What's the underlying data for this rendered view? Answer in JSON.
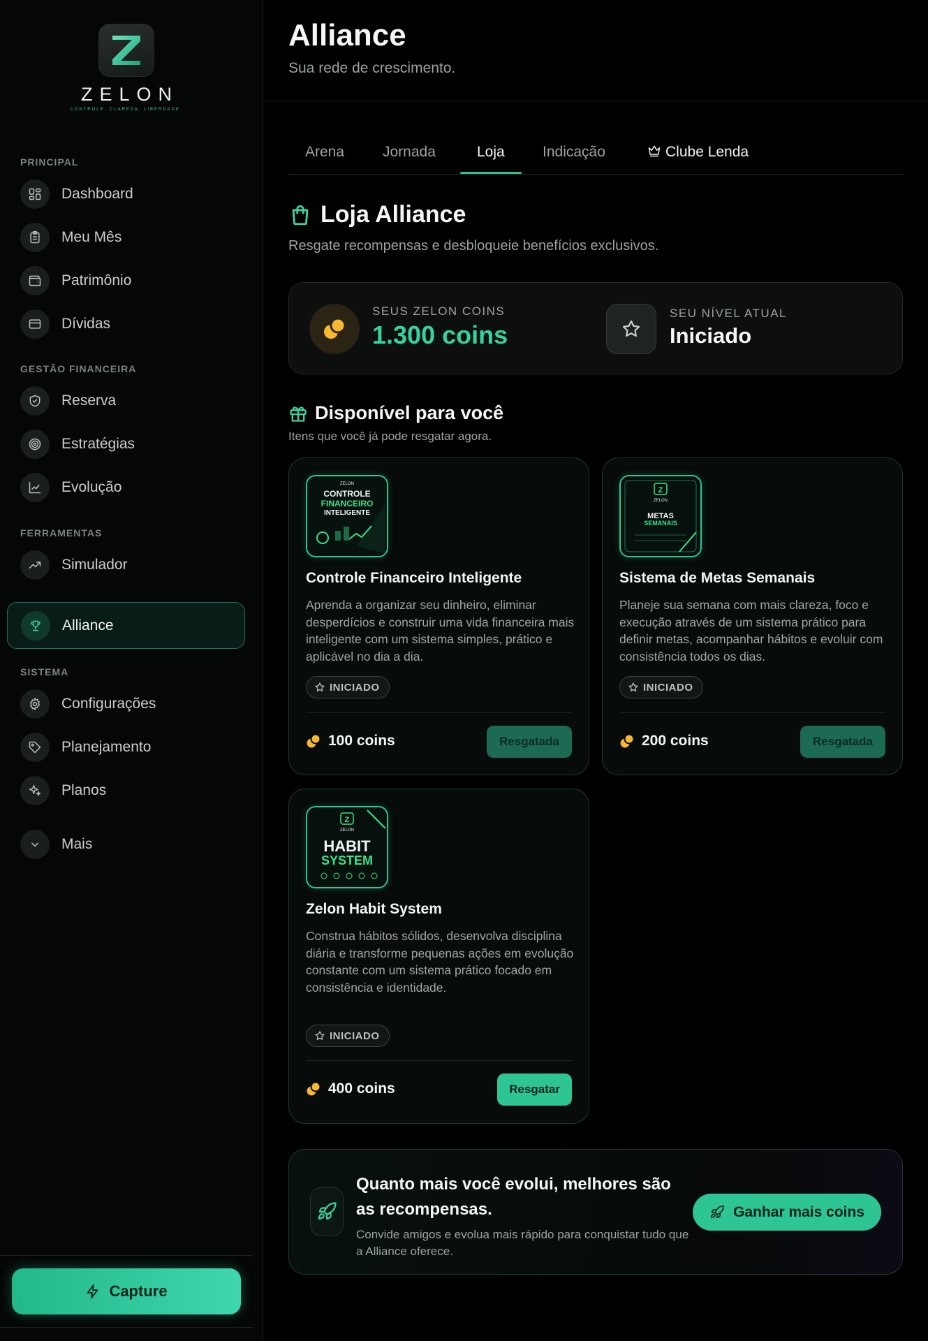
{
  "brand": {
    "name": "ZELON",
    "letter": "Z",
    "tagline": "CONTROLE. CLAREZA. LIBERDADE."
  },
  "sidebar": {
    "sections": [
      {
        "title": "PRINCIPAL"
      },
      {
        "title": "GESTÃO FINANCEIRA"
      },
      {
        "title": "FERRAMENTAS"
      },
      {
        "title": "SISTEMA"
      }
    ],
    "items": [
      {
        "label": "Dashboard",
        "icon": "dashboard-icon"
      },
      {
        "label": "Meu Mês",
        "icon": "clipboard-icon"
      },
      {
        "label": "Patrimônio",
        "icon": "wallet-icon"
      },
      {
        "label": "Dívidas",
        "icon": "credit-card-icon"
      },
      {
        "label": "Reserva",
        "icon": "shield-icon"
      },
      {
        "label": "Estratégias",
        "icon": "target-icon"
      },
      {
        "label": "Evolução",
        "icon": "chart-line-icon"
      },
      {
        "label": "Simulador",
        "icon": "trending-up-icon"
      },
      {
        "label": "Alliance",
        "icon": "trophy-icon",
        "active": true
      },
      {
        "label": "Configurações",
        "icon": "gear-icon"
      },
      {
        "label": "Planejamento",
        "icon": "tag-icon"
      },
      {
        "label": "Planos",
        "icon": "sparkles-icon"
      },
      {
        "label": "Mais",
        "icon": "chevron-down-icon"
      }
    ],
    "capture_label": "Capture"
  },
  "header": {
    "title": "Alliance",
    "subtitle": "Sua rede de crescimento."
  },
  "tabs": [
    {
      "label": "Arena"
    },
    {
      "label": "Jornada"
    },
    {
      "label": "Loja",
      "active": true
    },
    {
      "label": "Indicação"
    },
    {
      "label": "Clube Lenda",
      "icon": "crown-icon"
    }
  ],
  "store": {
    "title": "Loja Alliance",
    "subtitle": "Resgate recompensas e desbloqueie benefícios exclusivos.",
    "coins_label": "SEUS ZELON COINS",
    "coins_value": "1.300 coins",
    "level_label": "SEU NÍVEL ATUAL",
    "level_value": "Iniciado",
    "available_title": "Disponível para você",
    "available_subtitle": "Itens que você já pode resgatar agora."
  },
  "products": [
    {
      "title": "Controle Financeiro Inteligente",
      "description": "Aprenda a organizar seu dinheiro, eliminar desperdícios e construir uma vida financeira mais inteligente com um sistema simples, prático e aplicável no dia a dia.",
      "badge": "INICIADO",
      "price": "100 coins",
      "action": "Resgatada",
      "thumb_lines": [
        "ZELON",
        "CONTROLE",
        "FINANCEIRO",
        "INTELIGENTE"
      ]
    },
    {
      "title": "Sistema de Metas Semanais",
      "description": "Planeje sua semana com mais clareza, foco e execução através de um sistema prático para definir metas, acompanhar hábitos e evoluir com consistência todos os dias.",
      "badge": "INICIADO",
      "price": "200 coins",
      "action": "Resgatada",
      "thumb_lines": [
        "Z",
        "ZELON",
        "METAS",
        "SEMANAIS"
      ]
    },
    {
      "title": "Zelon Habit System",
      "description": "Construa hábitos sólidos, desenvolva disciplina diária e transforme pequenas ações em evolução constante com um sistema prático focado em consistência e identidade.",
      "badge": "INICIADO",
      "price": "400 coins",
      "action": "Resgatar",
      "thumb_lines": [
        "Z",
        "ZELON",
        "HABIT",
        "SYSTEM"
      ]
    }
  ],
  "cta": {
    "title": "Quanto mais você evolui, melhores são as recompensas.",
    "subtitle": "Convide amigos e evolua mais rápido para conquistar tudo que a Alliance oferece.",
    "button": "Ganhar mais coins"
  },
  "colors": {
    "accent": "#2dc594",
    "coin": "#f5b82e",
    "background": "#000000"
  }
}
